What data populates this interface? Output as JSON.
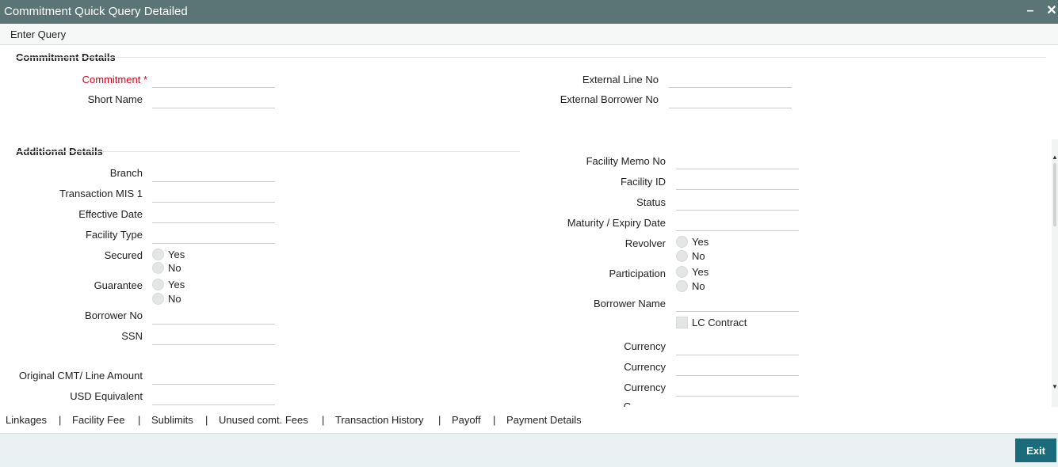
{
  "window": {
    "title": "Commitment Quick Query Detailed",
    "minimize_glyph": "–",
    "close_glyph": "✕"
  },
  "toolbar": {
    "enter_query": "Enter Query"
  },
  "commitment_details": {
    "heading": "Commitment Details",
    "commitment_label": "Commitment",
    "required_mark": "*",
    "short_name_label": "Short Name",
    "external_line_no_label": "External Line No",
    "external_borrower_no_label": "External Borrower No"
  },
  "additional_details": {
    "heading": "Additional Details",
    "branch_label": "Branch",
    "transaction_mis_label": "Transaction MIS 1",
    "effective_date_label": "Effective Date",
    "facility_type_label": "Facility Type",
    "secured_label": "Secured",
    "guarantee_label": "Guarantee",
    "borrower_no_label": "Borrower No",
    "ssn_label": "SSN",
    "original_cmt_label": "Original CMT/ Line Amount",
    "usd_equivalent_label": "USD Equivalent",
    "facility_memo_no_label": "Facility Memo No",
    "facility_id_label": "Facility ID",
    "status_label": "Status",
    "maturity_expiry_label": "Maturity / Expiry Date",
    "revolver_label": "Revolver",
    "participation_label": "Participation",
    "borrower_name_label": "Borrower Name",
    "lc_contract_label": "LC Contract",
    "currency_label_1": "Currency",
    "currency_label_2": "Currency",
    "currency_label_3": "Currency",
    "currency_label_4_partial": "C",
    "yes": "Yes",
    "no": "No"
  },
  "scrollbar": {
    "up_glyph": "▲",
    "down_glyph": "▼"
  },
  "links": {
    "items": [
      "Linkages",
      "Facility Fee",
      "Sublimits",
      "Unused comt. Fees",
      "Transaction History",
      "Payoff",
      "Payment Details"
    ],
    "separator": "|"
  },
  "footer": {
    "exit_label": "Exit"
  },
  "colors": {
    "titlebar": "#5b7577",
    "exit_button": "#1b6b7a",
    "required": "#d0021b",
    "footer": "#e9f1f2"
  }
}
